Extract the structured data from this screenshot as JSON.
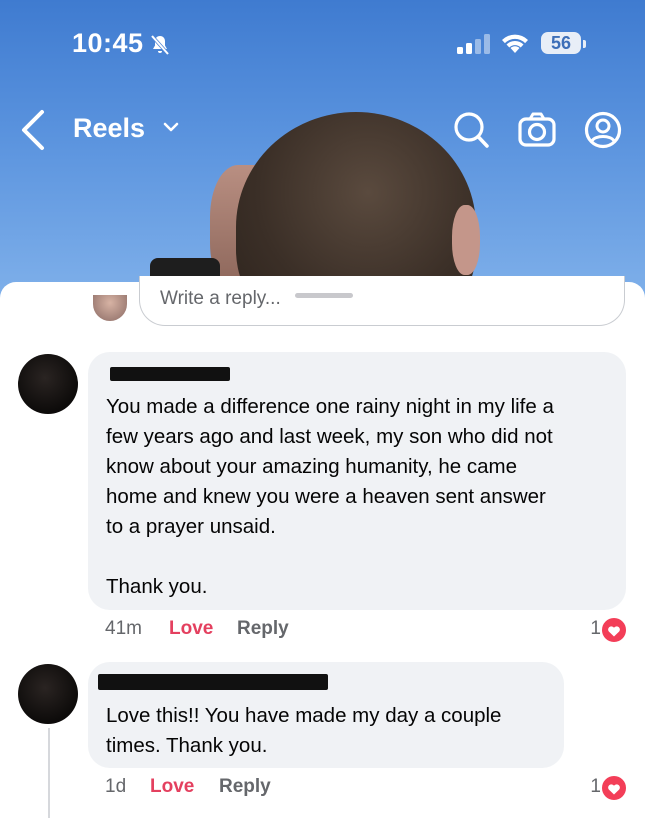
{
  "status_bar": {
    "time": "10:45",
    "battery": "56"
  },
  "navbar": {
    "title": "Reels"
  },
  "reply_box": {
    "placeholder": "Write a reply..."
  },
  "comments": [
    {
      "text": "You made a difference one rainy night in my life a\nfew years ago and last week, my son who did not\nknow about your amazing humanity, he came\nhome and knew you were a heaven sent answer\nto a prayer unsaid.\n\nThank you.",
      "time_ago": "41m",
      "love_label": "Love",
      "reply_label": "Reply",
      "reaction_count": "1"
    },
    {
      "text": "Love this!! You have made my day a couple\ntimes. Thank you.",
      "time_ago": "1d",
      "love_label": "Love",
      "reply_label": "Reply",
      "reaction_count": "1"
    }
  ],
  "colors": {
    "love_accent": "#e4405f",
    "heart_badge": "#f33e58",
    "bubble_bg": "#f0f2f5",
    "sky": "#5a93de"
  }
}
